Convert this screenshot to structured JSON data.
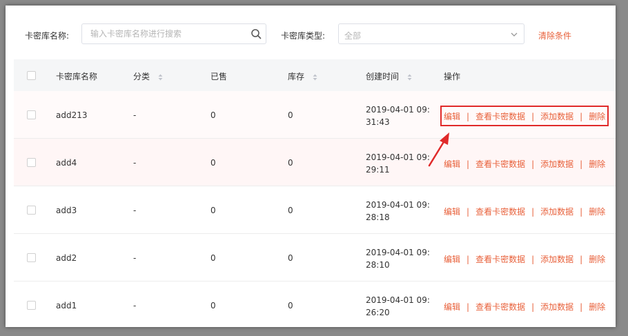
{
  "filters": {
    "name_label": "卡密库名称:",
    "search_placeholder": "输入卡密库名称进行搜索",
    "type_label": "卡密库类型:",
    "type_value": "全部",
    "clear_label": "清除条件"
  },
  "table": {
    "columns": {
      "name": "卡密库名称",
      "category": "分类",
      "sold": "已售",
      "stock": "库存",
      "created": "创建时间",
      "actions": "操作"
    },
    "action_labels": {
      "edit": "编辑",
      "view": "查看卡密数据",
      "add": "添加数据",
      "delete": "删除",
      "separator": "|"
    },
    "rows": [
      {
        "name": "add213",
        "category": "-",
        "sold": "0",
        "stock": "0",
        "created_date": "2019-04-01 09:",
        "created_time": "31:43"
      },
      {
        "name": "add4",
        "category": "-",
        "sold": "0",
        "stock": "0",
        "created_date": "2019-04-01 09:",
        "created_time": "29:11"
      },
      {
        "name": "add3",
        "category": "-",
        "sold": "0",
        "stock": "0",
        "created_date": "2019-04-01 09:",
        "created_time": "28:18"
      },
      {
        "name": "add2",
        "category": "-",
        "sold": "0",
        "stock": "0",
        "created_date": "2019-04-01 09:",
        "created_time": "28:10"
      },
      {
        "name": "add1",
        "category": "-",
        "sold": "0",
        "stock": "0",
        "created_date": "2019-04-01 09:",
        "created_time": "26:20"
      }
    ]
  },
  "colors": {
    "accent": "#e8613b",
    "highlight_box": "#e02a2a",
    "header_bg": "#f5f6f7",
    "hover_row_bg": "#fff6f6"
  },
  "icons": [
    "search-icon",
    "chevron-down-icon",
    "sort-icon",
    "arrow-annotation"
  ]
}
